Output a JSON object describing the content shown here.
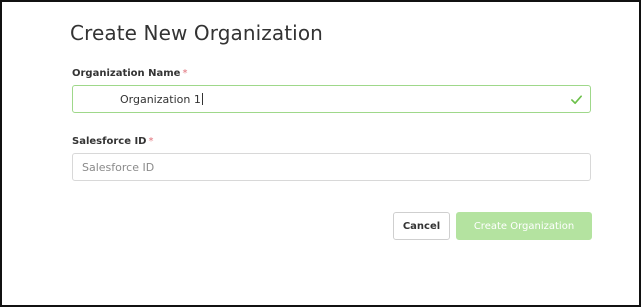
{
  "dialog": {
    "title": "Create New Organization"
  },
  "fields": {
    "organization_name": {
      "label": "Organization Name",
      "required_marker": "*",
      "value": "Organization 1",
      "valid": true
    },
    "salesforce_id": {
      "label": "Salesforce ID",
      "required_marker": "*",
      "value": "",
      "placeholder": "Salesforce ID"
    }
  },
  "actions": {
    "cancel_label": "Cancel",
    "create_label": "Create Organization",
    "create_enabled": false
  },
  "colors": {
    "valid_border": "#9fd88a",
    "check_icon": "#6cc04a",
    "required_marker": "#e0707a",
    "create_button_disabled": "#b4e3a0"
  },
  "icons": {
    "valid_indicator": "check-icon"
  }
}
